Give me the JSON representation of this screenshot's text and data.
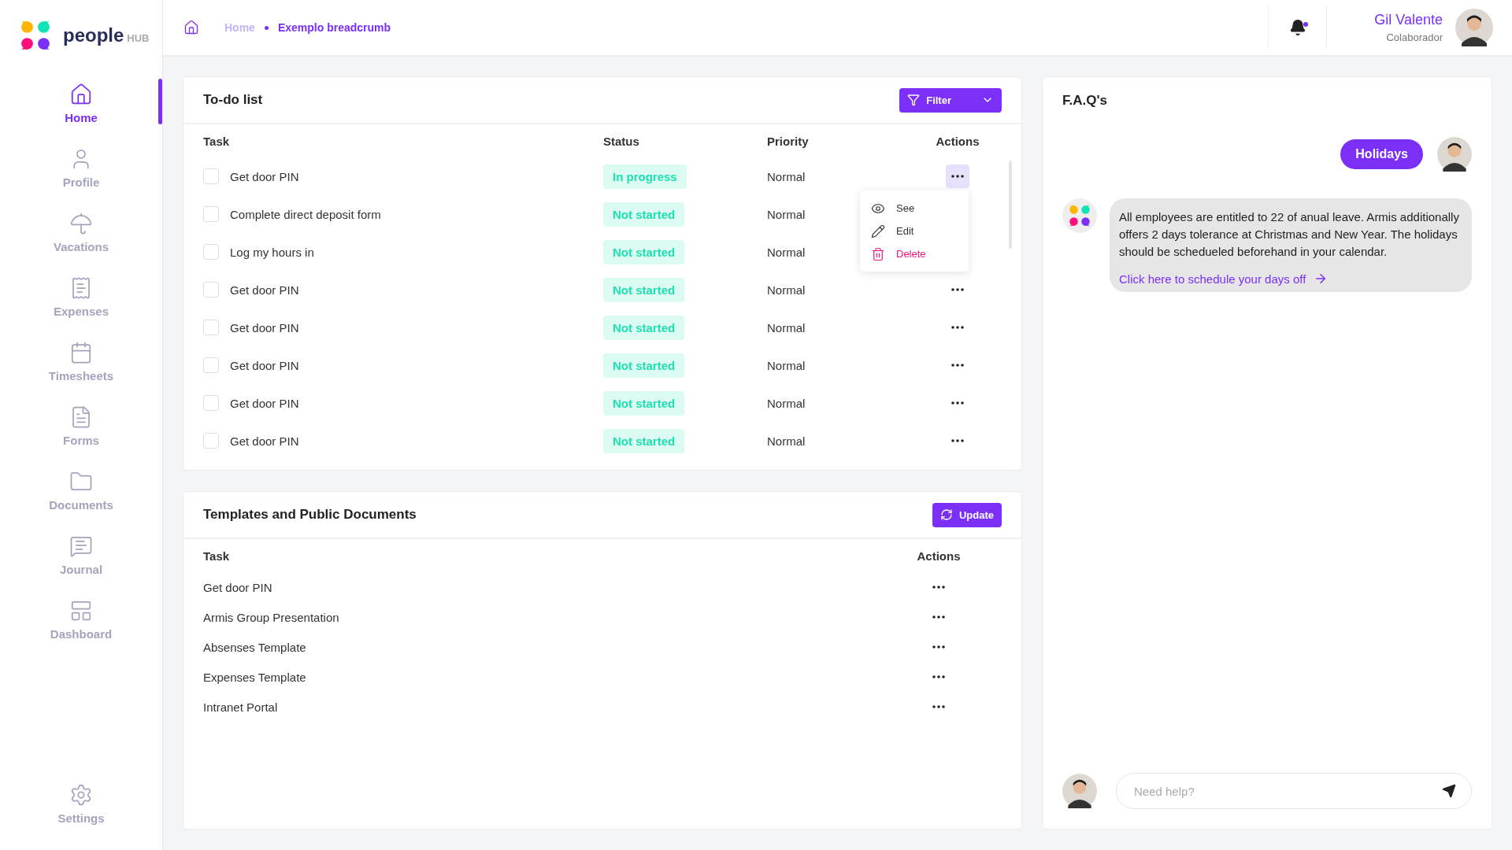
{
  "brand": {
    "name": "people",
    "suffix": "HUB"
  },
  "breadcrumb": [
    {
      "label": "Home",
      "current": false
    },
    {
      "label": "Exemplo breadcrumb",
      "current": true
    }
  ],
  "header": {
    "notifications": {
      "unread": true
    },
    "user": {
      "name": "Gil Valente",
      "role": "Colaborador"
    }
  },
  "sidebar": {
    "items": [
      {
        "kind": "home",
        "label": "Home",
        "selected": true
      },
      {
        "kind": "profile",
        "label": "Profile",
        "selected": false
      },
      {
        "kind": "vacations",
        "label": "Vacations",
        "selected": false
      },
      {
        "kind": "expenses",
        "label": "Expenses",
        "selected": false
      },
      {
        "kind": "timesheets",
        "label": "Timesheets",
        "selected": false
      },
      {
        "kind": "forms",
        "label": "Forms",
        "selected": false
      },
      {
        "kind": "documents",
        "label": "Documents",
        "selected": false
      },
      {
        "kind": "journal",
        "label": "Journal",
        "selected": false
      },
      {
        "kind": "dashboard",
        "label": "Dashboard",
        "selected": false
      }
    ],
    "footer": {
      "kind": "settings",
      "label": "Settings",
      "selected": false
    }
  },
  "todo": {
    "title": "To-do list",
    "filter_button": "Filter",
    "columns": [
      "Task",
      "Status",
      "Priority",
      "Actions"
    ],
    "rows": [
      {
        "task": "Get door PIN",
        "checked": false,
        "status": "In progress",
        "priority": "Normal",
        "menu_open": true
      },
      {
        "task": "Complete direct deposit form",
        "checked": false,
        "status": "Not started",
        "priority": "Normal",
        "menu_open": false
      },
      {
        "task": "Log my hours in",
        "checked": false,
        "status": "Not started",
        "priority": "Normal",
        "menu_open": false
      },
      {
        "task": "Get door PIN",
        "checked": false,
        "status": "Not started",
        "priority": "Normal",
        "menu_open": false
      },
      {
        "task": "Get door PIN",
        "checked": false,
        "status": "Not started",
        "priority": "Normal",
        "menu_open": false
      },
      {
        "task": "Get door PIN",
        "checked": false,
        "status": "Not started",
        "priority": "Normal",
        "menu_open": false
      },
      {
        "task": "Get door PIN",
        "checked": false,
        "status": "Not started",
        "priority": "Normal",
        "menu_open": false
      },
      {
        "task": "Get door PIN",
        "checked": false,
        "status": "Not started",
        "priority": "Normal",
        "menu_open": false
      }
    ],
    "menu": [
      {
        "kind": "see",
        "label": "See"
      },
      {
        "kind": "edit",
        "label": "Edit"
      },
      {
        "kind": "delete",
        "label": "Delete"
      }
    ]
  },
  "templates": {
    "title": "Templates and Public Documents",
    "update_button": "Update",
    "columns": [
      "Task",
      "Actions"
    ],
    "rows": [
      "Get door PIN",
      "Armis Group Presentation",
      "Absenses Template",
      "Expenses Template",
      "Intranet Portal"
    ]
  },
  "faq": {
    "title": "F.A.Q's",
    "messages": [
      {
        "kind": "user",
        "text": "Holidays"
      },
      {
        "kind": "bot",
        "text": "All employees are entitled to 22 of anual leave. Armis additionally offers 2 days tolerance at Christmas and New Year. The holidays should be schedueled beforehand in your calendar.",
        "link": "Click here to schedule your days off"
      }
    ],
    "input": {
      "placeholder": "Need help?"
    }
  }
}
